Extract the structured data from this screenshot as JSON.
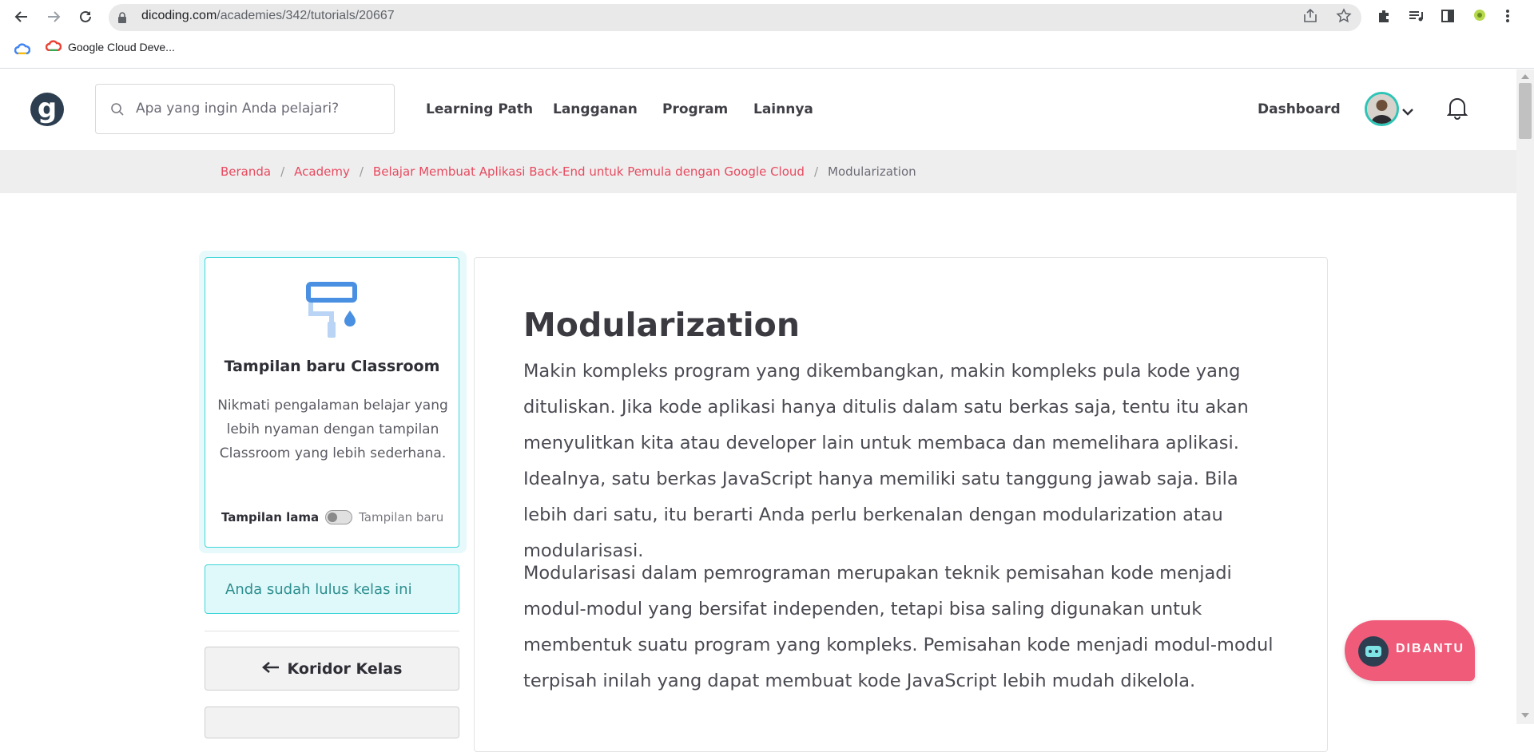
{
  "browser": {
    "url_host": "dicoding.com",
    "url_path": "/academies/342/tutorials/20667",
    "bookmark_label": "Google Cloud Deve..."
  },
  "header": {
    "logo_text": "g",
    "search_placeholder": "Apa yang ingin Anda pelajari?",
    "nav": [
      "Learning Path",
      "Langganan",
      "Program",
      "Lainnya"
    ],
    "dashboard_label": "Dashboard"
  },
  "breadcrumb": {
    "items": [
      "Beranda",
      "Academy",
      "Belajar Membuat Aplikasi Back-End untuk Pemula dengan Google Cloud"
    ],
    "current": "Modularization",
    "separator": "/"
  },
  "sidebar": {
    "promo_title": "Tampilan baru Classroom",
    "promo_desc": "Nikmati pengalaman belajar yang lebih nyaman dengan tampilan Classroom yang lebih sederhana.",
    "toggle_old": "Tampilan lama",
    "toggle_new": "Tampilan baru",
    "passed_text": "Anda sudah lulus kelas ini",
    "korid_label": "Koridor Kelas"
  },
  "article": {
    "title": "Modularization",
    "p1": "Makin kompleks program yang dikembangkan, makin kompleks pula kode yang dituliskan. Jika kode aplikasi hanya ditulis dalam satu berkas saja, tentu itu akan menyulitkan kita atau developer lain untuk membaca dan memelihara aplikasi. Idealnya, satu berkas JavaScript hanya memiliki satu tanggung jawab saja. Bila lebih dari satu, itu berarti Anda perlu berkenalan dengan modularization atau modularisasi.",
    "p2": "Modularisasi dalam pemrograman merupakan teknik pemisahan kode menjadi modul-modul yang bersifat independen, tetapi bisa saling digunakan untuk membentuk suatu program yang kompleks. Pemisahan kode menjadi modul-modul terpisah inilah yang dapat membuat kode JavaScript lebih mudah dikelola."
  },
  "help": {
    "label": "DIBANTU"
  },
  "colors": {
    "accent_pink": "#e84a5f",
    "accent_teal": "#3ed6d9",
    "help_bg": "#f05b7a"
  }
}
